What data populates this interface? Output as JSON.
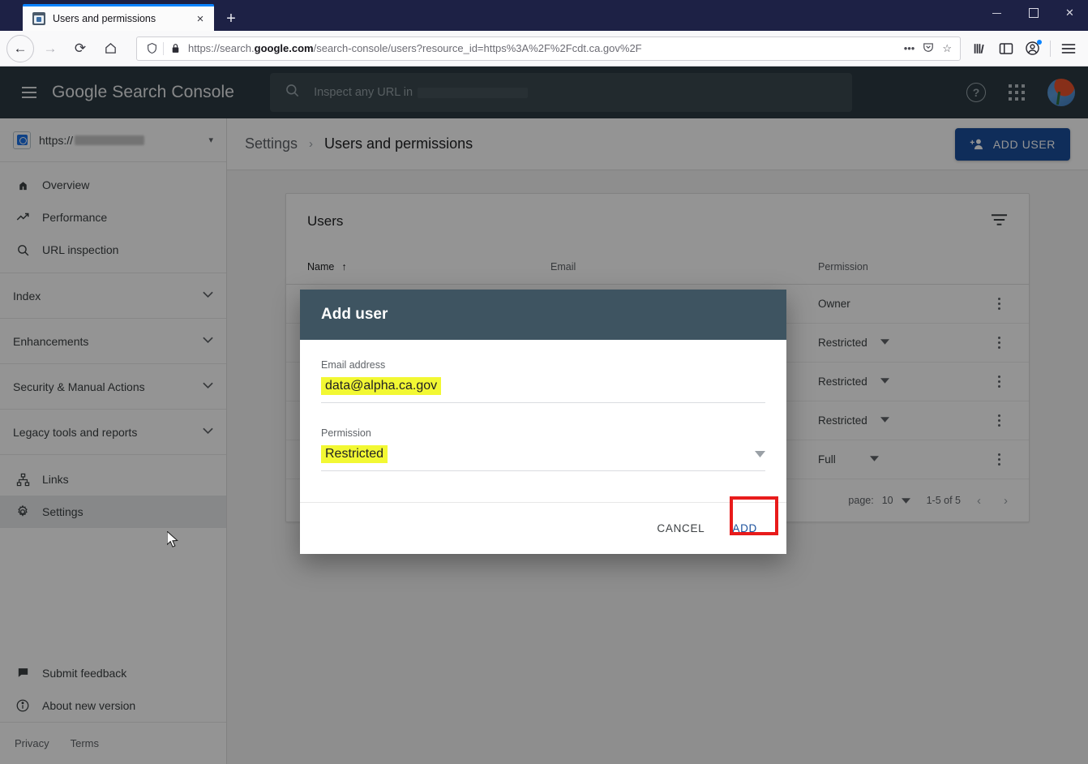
{
  "browser": {
    "tab": {
      "title": "Users and permissions",
      "close_label": "×",
      "favicon": "search-console-favicon"
    },
    "new_tab_label": "+",
    "window_controls": {
      "minimize": "−",
      "maximize": "□",
      "close": "✕"
    },
    "nav": {
      "back": "←",
      "forward": "→",
      "reload": "⟳",
      "home": "⌂"
    },
    "url": {
      "prefix": "https://search.",
      "bold": "google.com",
      "suffix": "/search-console/users?resource_id=https%3A%2F%2Fcdt.ca.gov%2F",
      "shield_icon": "shield-icon",
      "lock_icon": "lock-icon",
      "more_icon": "•••",
      "pocket_icon": "pocket-icon",
      "bookmark_icon": "☆"
    },
    "toolbar_icons": [
      "library-icon",
      "sidebar-icon",
      "account-icon",
      "app-menu-icon"
    ]
  },
  "app": {
    "header": {
      "menu_icon": "hamburger-menu-icon",
      "logo_google": "Google",
      "logo_product": "Search Console",
      "search_placeholder": "Inspect any URL in",
      "search_icon": "search-icon",
      "help_icon": "?",
      "apps_icon": "apps-grid-icon",
      "avatar_icon": "user-avatar"
    },
    "sidebar": {
      "property": {
        "prefix": "https://",
        "caret": "▾"
      },
      "primary_items": [
        {
          "label": "Overview",
          "icon": "home-icon"
        },
        {
          "label": "Performance",
          "icon": "trending-up-icon"
        },
        {
          "label": "URL inspection",
          "icon": "search-icon"
        }
      ],
      "collapsible_items": [
        {
          "label": "Index",
          "chevron": "⌄"
        },
        {
          "label": "Enhancements",
          "chevron": "⌄"
        },
        {
          "label": "Security & Manual Actions",
          "chevron": "⌄"
        },
        {
          "label": "Legacy tools and reports",
          "chevron": "⌄"
        }
      ],
      "bottom_items": [
        {
          "label": "Links",
          "icon": "links-sitemap-icon"
        },
        {
          "label": "Settings",
          "icon": "gear-icon",
          "selected": true
        }
      ],
      "footer_items": [
        {
          "label": "Submit feedback",
          "icon": "feedback-icon"
        },
        {
          "label": "About new version",
          "icon": "info-icon"
        }
      ],
      "legal": [
        "Privacy",
        "Terms"
      ]
    },
    "breadcrumb": {
      "parent": "Settings",
      "separator": "›",
      "current": "Users and permissions"
    },
    "add_user_button": {
      "label": "ADD USER",
      "icon": "person-add-icon"
    },
    "card": {
      "title": "Users",
      "filter_icon": "filter-icon",
      "columns": {
        "name": "Name",
        "name_sort": "↑",
        "email": "Email",
        "permission": "Permission"
      },
      "rows": [
        {
          "name": "",
          "email": "",
          "permission": "Owner",
          "has_caret": false,
          "menu_icon": "more-vert-icon"
        },
        {
          "name": "",
          "email": "",
          "permission": "Restricted",
          "has_caret": true,
          "menu_icon": "more-vert-icon"
        },
        {
          "name": "",
          "email": "",
          "permission": "Restricted",
          "has_caret": true,
          "menu_icon": "more-vert-icon"
        },
        {
          "name": "",
          "email": "",
          "permission": "Restricted",
          "has_caret": true,
          "menu_icon": "more-vert-icon"
        },
        {
          "name": "",
          "email": "",
          "permission": "Full",
          "has_caret": true,
          "menu_icon": "more-vert-icon"
        }
      ],
      "pager": {
        "rows_per_page_label": "page:",
        "rows_per_page_value": "10",
        "caret": "▾",
        "range": "1-5 of 5",
        "prev": "‹",
        "next": "›"
      }
    },
    "dialog": {
      "title": "Add user",
      "email_label": "Email address",
      "email_value": "data@alpha.ca.gov",
      "permission_label": "Permission",
      "permission_value": "Restricted",
      "permission_caret": "▾",
      "cancel_label": "CANCEL",
      "add_label": "ADD",
      "highlight_color": "#e81b1b",
      "field_highlight_color": "#f2f833",
      "header_color": "#3e5461"
    }
  }
}
